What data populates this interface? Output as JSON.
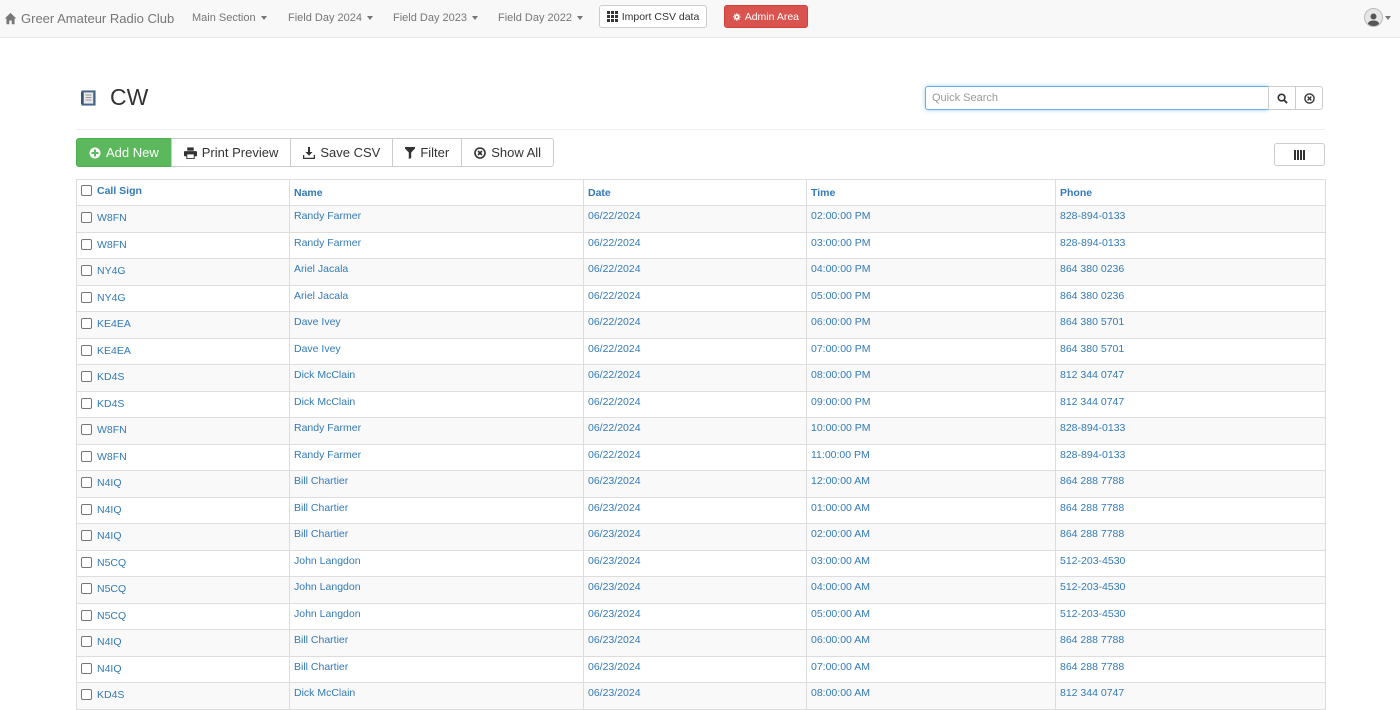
{
  "navbar": {
    "brand": "Greer Amateur Radio Club",
    "menus": [
      {
        "label": "Main Section"
      },
      {
        "label": "Field Day 2024"
      },
      {
        "label": "Field Day 2023"
      },
      {
        "label": "Field Day 2022"
      }
    ],
    "import_label": "Import CSV data",
    "admin_label": "Admin Area",
    "admin_color": "#d9534f"
  },
  "page": {
    "title": "CW",
    "search_placeholder": "Quick Search"
  },
  "toolbar": {
    "add_new": "Add New",
    "print_preview": "Print Preview",
    "save_csv": "Save CSV",
    "filter": "Filter",
    "show_all": "Show All",
    "add_color": "#5cb85c"
  },
  "table": {
    "headers": [
      "Call Sign",
      "Name",
      "Date",
      "Time",
      "Phone"
    ],
    "rows": [
      [
        "W8FN",
        "Randy Farmer",
        "06/22/2024",
        "02:00:00 PM",
        "828-894-0133"
      ],
      [
        "W8FN",
        "Randy Farmer",
        "06/22/2024",
        "03:00:00 PM",
        "828-894-0133"
      ],
      [
        "NY4G",
        "Ariel Jacala",
        "06/22/2024",
        "04:00:00 PM",
        "864 380 0236"
      ],
      [
        "NY4G",
        "Ariel Jacala",
        "06/22/2024",
        "05:00:00 PM",
        "864 380 0236"
      ],
      [
        "KE4EA",
        "Dave Ivey",
        "06/22/2024",
        "06:00:00 PM",
        "864 380 5701"
      ],
      [
        "KE4EA",
        "Dave Ivey",
        "06/22/2024",
        "07:00:00 PM",
        "864 380 5701"
      ],
      [
        "KD4S",
        "Dick McClain",
        "06/22/2024",
        "08:00:00 PM",
        "812 344 0747"
      ],
      [
        "KD4S",
        "Dick McClain",
        "06/22/2024",
        "09:00:00 PM",
        "812 344 0747"
      ],
      [
        "W8FN",
        "Randy Farmer",
        "06/22/2024",
        "10:00:00 PM",
        "828-894-0133"
      ],
      [
        "W8FN",
        "Randy Farmer",
        "06/22/2024",
        "11:00:00 PM",
        "828-894-0133"
      ],
      [
        "N4IQ",
        "Bill Chartier",
        "06/23/2024",
        "12:00:00 AM",
        "864 288 7788"
      ],
      [
        "N4IQ",
        "Bill Chartier",
        "06/23/2024",
        "01:00:00 AM",
        "864 288 7788"
      ],
      [
        "N4IQ",
        "Bill Chartier",
        "06/23/2024",
        "02:00:00 AM",
        "864 288 7788"
      ],
      [
        "N5CQ",
        "John Langdon",
        "06/23/2024",
        "03:00:00 AM",
        "512-203-4530"
      ],
      [
        "N5CQ",
        "John Langdon",
        "06/23/2024",
        "04:00:00 AM",
        "512-203-4530"
      ],
      [
        "N5CQ",
        "John Langdon",
        "06/23/2024",
        "05:00:00 AM",
        "512-203-4530"
      ],
      [
        "N4IQ",
        "Bill Chartier",
        "06/23/2024",
        "06:00:00 AM",
        "864 288 7788"
      ],
      [
        "N4IQ",
        "Bill Chartier",
        "06/23/2024",
        "07:00:00 AM",
        "864 288 7788"
      ],
      [
        "KD4S",
        "Dick McClain",
        "06/23/2024",
        "08:00:00 AM",
        "812 344 0747"
      ]
    ]
  },
  "icons": {
    "brand": "home-icon",
    "title": "notebook-icon",
    "search": "search-icon",
    "clear": "clear-icon",
    "add": "plus-circle-icon",
    "print": "print-icon",
    "save": "download-icon",
    "filter": "filter-icon",
    "show_all": "times-circle-icon",
    "columns": "columns-icon",
    "user": "user-icon"
  }
}
